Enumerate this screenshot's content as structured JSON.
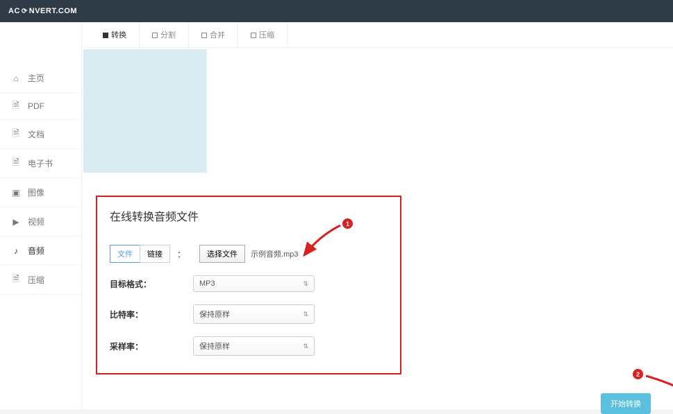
{
  "header": {
    "logo_prefix": "AC",
    "logo_suffix": "NVERT.COM"
  },
  "sidebar": {
    "items": [
      {
        "label": "主页",
        "icon": "home"
      },
      {
        "label": "PDF",
        "icon": "pdf"
      },
      {
        "label": "文档",
        "icon": "doc"
      },
      {
        "label": "电子书",
        "icon": "ebook"
      },
      {
        "label": "图像",
        "icon": "image"
      },
      {
        "label": "视频",
        "icon": "video"
      },
      {
        "label": "音频",
        "icon": "audio",
        "active": true
      },
      {
        "label": "压缩",
        "icon": "archive"
      }
    ]
  },
  "tabs": [
    {
      "label": "转换",
      "active": true
    },
    {
      "label": "分割"
    },
    {
      "label": "合并"
    },
    {
      "label": "压缩"
    }
  ],
  "form": {
    "title": "在线转换音频文件",
    "source": {
      "file_tab": "文件",
      "link_tab": "链接",
      "choose_button": "选择文件",
      "filename": "示例音频.mp3"
    },
    "target_format": {
      "label": "目标格式：",
      "value": "MP3"
    },
    "bitrate": {
      "label": "比特率：",
      "value": "保持原样"
    },
    "samplerate": {
      "label": "采样率：",
      "value": "保持原样"
    }
  },
  "annotations": {
    "badge1": "1",
    "badge2": "2"
  },
  "submit_button": "开始转换"
}
